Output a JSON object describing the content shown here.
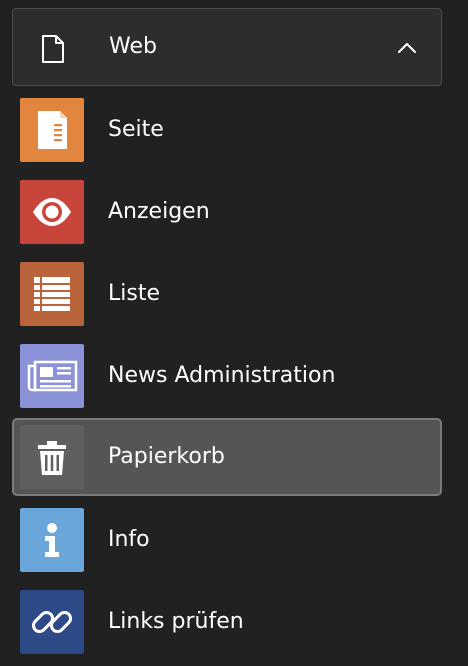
{
  "group": {
    "label": "Web",
    "icon": "document-icon",
    "expanded": true
  },
  "modules": [
    {
      "label": "Seite",
      "icon": "page-icon",
      "color": "#e2863f",
      "active": false
    },
    {
      "label": "Anzeigen",
      "icon": "eye-icon",
      "color": "#c8453c",
      "active": false
    },
    {
      "label": "Liste",
      "icon": "list-icon",
      "color": "#b9643a",
      "active": false
    },
    {
      "label": "News Administration",
      "icon": "newspaper-icon",
      "color": "#8b92d7",
      "active": false
    },
    {
      "label": "Papierkorb",
      "icon": "trash-icon",
      "color": "#5d605e",
      "active": true
    },
    {
      "label": "Info",
      "icon": "info-icon",
      "color": "#6ba6db",
      "active": false
    },
    {
      "label": "Links prüfen",
      "icon": "link-icon",
      "color": "#2e4a86",
      "active": false
    }
  ]
}
